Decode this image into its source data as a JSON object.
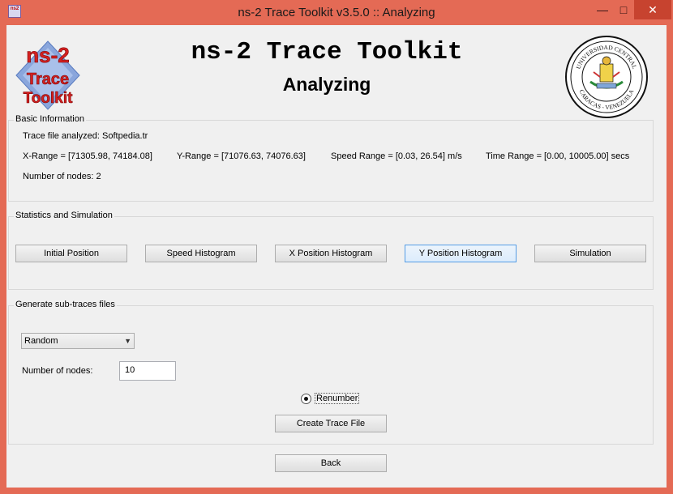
{
  "window": {
    "title": "ns-2 Trace Toolkit v3.5.0 :: Analyzing",
    "minimize": "—",
    "maximize": "□",
    "close": "✕"
  },
  "header": {
    "title": "ns-2 Trace Toolkit",
    "subtitle": "Analyzing",
    "logo_lines": [
      "ns-2",
      "Trace",
      "Toolkit"
    ],
    "seal_text_top": "UNIVERSIDAD CENTRAL",
    "seal_text_bottom": "CARACAS - VENEZUELA"
  },
  "basic_info": {
    "title": "Basic Information",
    "trace_file": "Trace file analyzed: Softpedia.tr",
    "x_range": "X-Range = [71305.98, 74184.08]",
    "y_range": "Y-Range = [71076.63, 74076.63]",
    "speed_range": "Speed Range = [0.03, 26.54] m/s",
    "time_range": "Time Range = [0.00, 10005.00] secs",
    "num_nodes": "Number of nodes: 2"
  },
  "statistics": {
    "title": "Statistics and Simulation",
    "buttons": [
      "Initial Position",
      "Speed Histogram",
      "X Position Histogram",
      "Y Position Histogram",
      "Simulation"
    ]
  },
  "subtraces": {
    "title": "Generate sub-traces files",
    "mode_selected": "Random",
    "nodes_label": "Number of nodes:",
    "nodes_value": "10",
    "renumber_label": "Renumber",
    "renumber_checked": true,
    "create_button": "Create Trace File"
  },
  "footer": {
    "back_button": "Back"
  },
  "colors": {
    "window_frame": "#e46a55",
    "close_button": "#c7432f",
    "client_background": "#f0f0f0",
    "focused_button_border": "#569de5"
  }
}
